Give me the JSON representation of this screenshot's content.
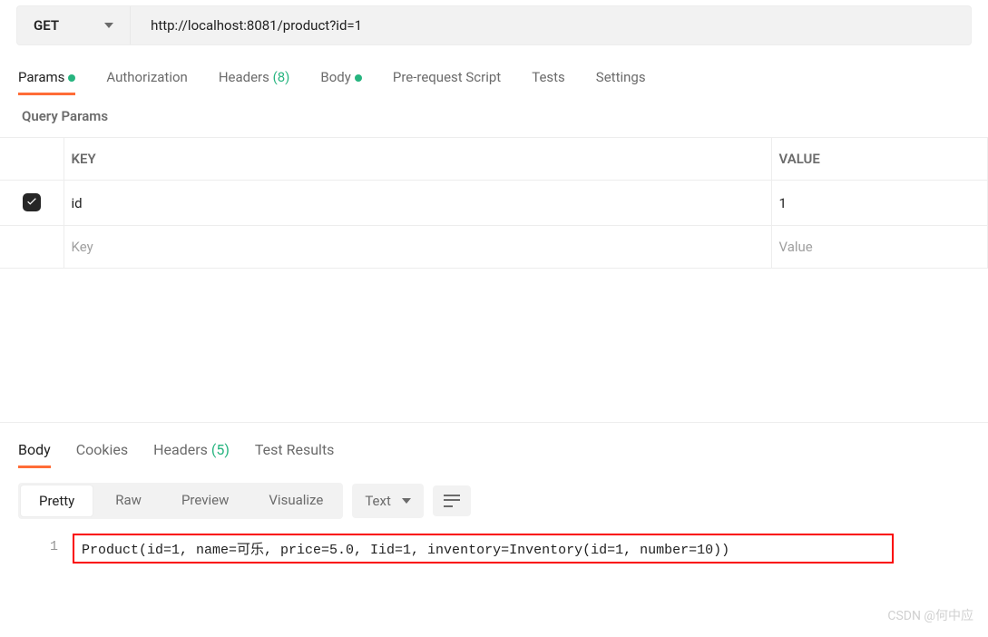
{
  "request": {
    "method": "GET",
    "url": "http://localhost:8081/product?id=1"
  },
  "reqTabs": {
    "params": "Params",
    "authorization": "Authorization",
    "headers": "Headers",
    "headersCount": "(8)",
    "body": "Body",
    "prereq": "Pre-request Script",
    "tests": "Tests",
    "settings": "Settings"
  },
  "queryParams": {
    "title": "Query Params",
    "headers": {
      "key": "KEY",
      "value": "VALUE"
    },
    "rows": [
      {
        "checked": true,
        "key": "id",
        "value": "1"
      }
    ],
    "placeholders": {
      "key": "Key",
      "value": "Value"
    }
  },
  "respTabs": {
    "body": "Body",
    "cookies": "Cookies",
    "headers": "Headers",
    "headersCount": "(5)",
    "tests": "Test Results"
  },
  "viewTabs": {
    "pretty": "Pretty",
    "raw": "Raw",
    "preview": "Preview",
    "visualize": "Visualize"
  },
  "formatSelect": "Text",
  "response": {
    "lineNum": "1",
    "content": "Product(id=1, name=可乐, price=5.0, Iid=1, inventory=Inventory(id=1, number=10))"
  },
  "watermark": "CSDN @何中应"
}
